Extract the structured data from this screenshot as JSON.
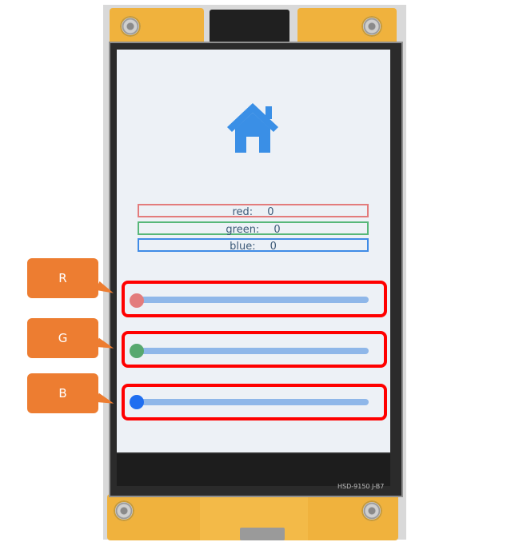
{
  "values": {
    "red": {
      "label": "red:",
      "value": "0"
    },
    "green": {
      "label": "green:",
      "value": "0"
    },
    "blue": {
      "label": "blue:",
      "value": "0"
    }
  },
  "sliders": {
    "red": {
      "value": 0,
      "max": 255
    },
    "green": {
      "value": 0,
      "max": 255
    },
    "blue": {
      "value": 0,
      "max": 255
    }
  },
  "callouts": {
    "r": "R",
    "g": "G",
    "b": "B"
  },
  "lcd_model": "HSD-9150 J-B7",
  "icons": {
    "home": "home-icon"
  },
  "colors": {
    "red_accent": "#e37c7c",
    "green_accent": "#57b779",
    "blue_accent": "#3f8be6",
    "callout": "#ed7d31",
    "highlight": "#ff0000"
  }
}
